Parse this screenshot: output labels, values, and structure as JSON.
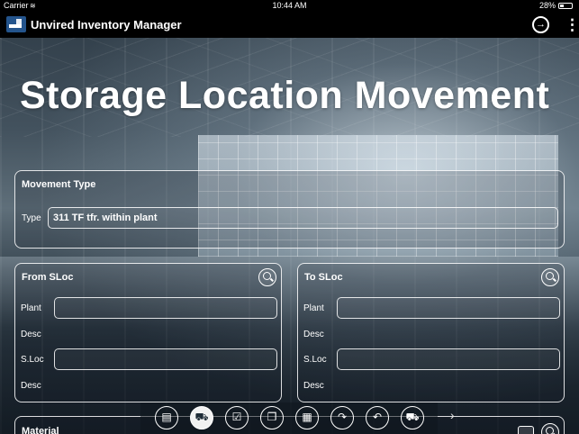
{
  "status_bar": {
    "carrier": "Carrier",
    "time": "10:44 AM",
    "battery": "28%"
  },
  "app_bar": {
    "title": "Unvired Inventory Manager",
    "logo_icon": "forklift-logo-icon",
    "action_icon": "arrow-right-circle-icon",
    "menu_icon": "more-vertical-icon"
  },
  "page": {
    "title": "Storage Location Movement"
  },
  "movement_type": {
    "heading": "Movement Type",
    "type_label": "Type",
    "type_value": "311 TF tfr. within plant"
  },
  "from_sloc": {
    "heading": "From SLoc",
    "plant_label": "Plant",
    "plant_value": "",
    "desc1_label": "Desc",
    "sloc_label": "S.Loc",
    "sloc_value": "",
    "desc2_label": "Desc"
  },
  "to_sloc": {
    "heading": "To SLoc",
    "plant_label": "Plant",
    "plant_value": "",
    "desc1_label": "Desc",
    "sloc_label": "S.Loc",
    "sloc_value": "",
    "desc2_label": "Desc"
  },
  "toolbar": {
    "items": [
      {
        "icon": "briefcase-icon",
        "glyph": "▤"
      },
      {
        "icon": "forklift-icon",
        "glyph": "⛟",
        "active": true
      },
      {
        "icon": "clipboard-check-icon",
        "glyph": "☑"
      },
      {
        "icon": "document-icon",
        "glyph": "❐"
      },
      {
        "icon": "pallet-icon",
        "glyph": "▦"
      },
      {
        "icon": "redo-arrow-icon",
        "glyph": "↷"
      },
      {
        "icon": "undo-arrow-icon",
        "glyph": "↶"
      },
      {
        "icon": "truck-icon",
        "glyph": "⛟"
      }
    ],
    "next_glyph": "›"
  },
  "material": {
    "heading": "Material"
  }
}
